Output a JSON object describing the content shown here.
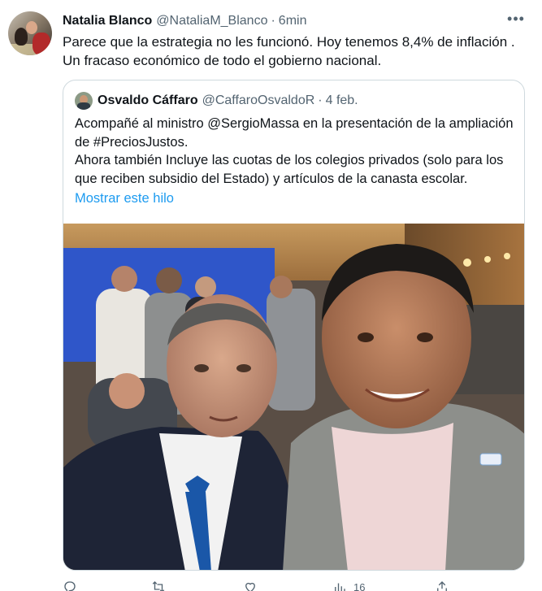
{
  "tweet": {
    "display_name": "Natalia Blanco",
    "handle": "@NataliaM_Blanco",
    "separator": "·",
    "time": "6min",
    "more": "•••",
    "text": "Parece que la estrategia no les funcionó. Hoy tenemos 8,4% de inflación . Un fracaso económico de todo el gobierno nacional."
  },
  "quote": {
    "display_name": "Osvaldo Cáffaro",
    "handle": "@CaffaroOsvaldoR",
    "separator": "·",
    "time": "4 feb.",
    "text_line1": "Acompañé al ministro @SergioMassa en la presentación de la ampliación de #PreciosJustos.",
    "text_line2": "Ahora también Incluye las cuotas de los colegios privados (solo para los que reciben subsidio del Estado) y artículos de la canasta escolar.",
    "show_thread": "Mostrar este hilo"
  },
  "actions": {
    "reply_icon": "reply-icon",
    "retweet_icon": "retweet-icon",
    "like_icon": "like-icon",
    "views_icon": "views-icon",
    "views_count": "16",
    "share_icon": "share-icon"
  },
  "colors": {
    "link": "#1d9bf0",
    "secondary_text": "#536471",
    "border": "#cfd9de"
  }
}
